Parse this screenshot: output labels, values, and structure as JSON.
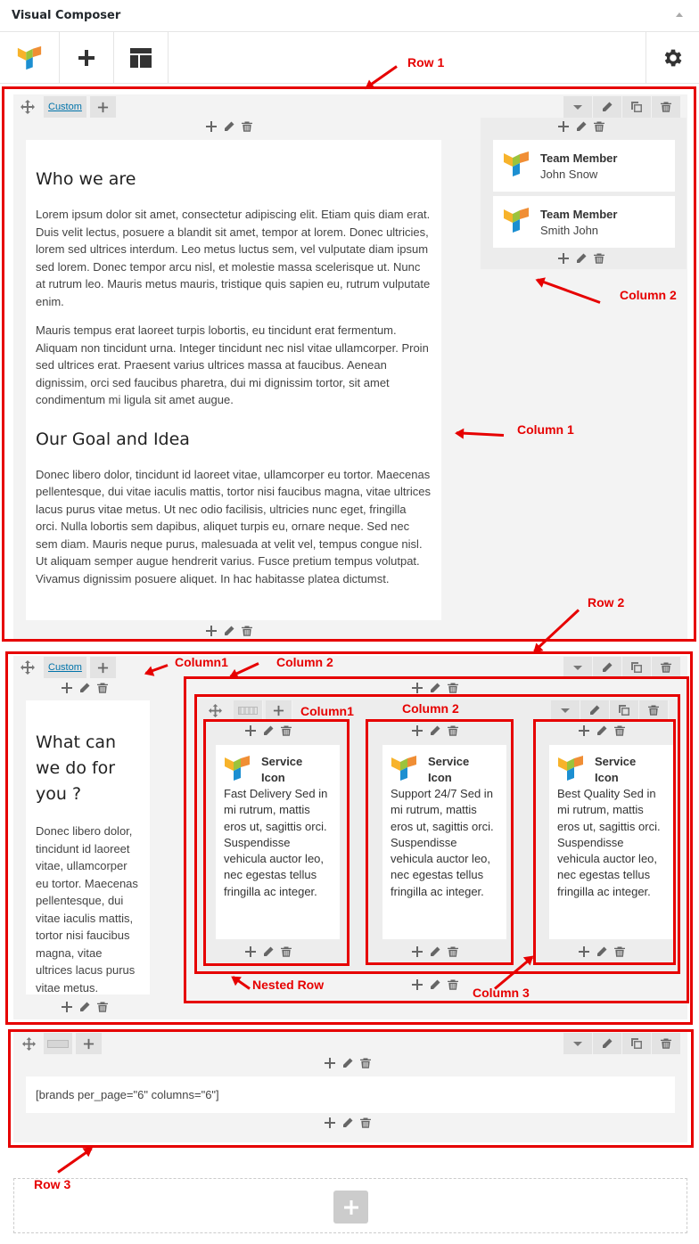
{
  "title": "Visual Composer",
  "row1": {
    "custom_label": "Custom",
    "col1": {
      "heading1": "Who we are",
      "para1": "Lorem ipsum dolor sit amet, consectetur adipiscing elit. Etiam quis diam erat. Duis velit lectus, posuere a blandit sit amet, tempor at lorem. Donec ultricies, lorem sed ultrices interdum. Leo metus luctus sem, vel vulputate diam ipsum sed lorem. Donec tempor arcu nisl, et molestie massa scelerisque ut. Nunc at rutrum leo. Mauris metus mauris, tristique quis sapien eu, rutrum vulputate enim.",
      "para2": "Mauris tempus erat laoreet turpis lobortis, eu tincidunt erat fermentum. Aliquam non tincidunt urna. Integer tincidunt nec nisl vitae ullamcorper. Proin sed ultrices erat. Praesent varius ultrices massa at faucibus. Aenean dignissim, orci sed faucibus pharetra, dui mi dignissim tortor, sit amet condimentum mi ligula sit amet augue.",
      "heading2": "Our Goal and Idea",
      "para3": "Donec libero dolor, tincidunt id laoreet vitae, ullamcorper eu tortor. Maecenas pellentesque, dui vitae iaculis mattis, tortor nisi faucibus magna, vitae ultrices lacus purus vitae metus. Ut nec odio facilisis, ultricies nunc eget, fringilla orci. Nulla lobortis sem dapibus, aliquet turpis eu, ornare neque. Sed nec sem diam. Mauris neque purus, malesuada at velit vel, tempus congue nisl. Ut aliquam semper augue hendrerit varius. Fusce pretium tempus volutpat. Vivamus dignissim posuere aliquet. In hac habitasse platea dictumst."
    },
    "col2": {
      "members": [
        {
          "title": "Team Member",
          "name": "John Snow"
        },
        {
          "title": "Team Member",
          "name": "Smith John"
        }
      ]
    }
  },
  "row2": {
    "custom_label": "Custom",
    "col1": {
      "heading": "What can we do for you ?",
      "para": "Donec libero dolor, tincidunt id laoreet vitae, ullamcorper eu tortor. Maecenas pellentesque, dui vitae iaculis mattis, tortor nisi faucibus magna, vitae ultrices lacus purus vitae metus."
    },
    "services": [
      {
        "title1": "Service",
        "title2": "Icon",
        "text": "Fast Delivery Sed in mi rutrum, mattis eros ut, sagittis orci. Suspendisse vehicula auctor leo, nec egestas tellus fringilla ac integer."
      },
      {
        "title1": "Service",
        "title2": "Icon",
        "text": "Support 24/7 Sed in mi rutrum, mattis eros ut, sagittis orci. Suspendisse vehicula auctor leo, nec egestas tellus fringilla ac integer."
      },
      {
        "title1": "Service",
        "title2": "Icon",
        "text": "Best Quality Sed in mi rutrum, mattis eros ut, sagittis orci. Suspendisse vehicula auctor leo, nec egestas tellus fringilla ac integer."
      }
    ]
  },
  "row3": {
    "shortcode": "[brands per_page=\"6\" columns=\"6\"]"
  },
  "annotations": {
    "row1": "Row 1",
    "row2": "Row 2",
    "row3": "Row 3",
    "column1": "Column 1",
    "column2": "Column 2",
    "r2_column1": "Column1",
    "r2_column2": "Column 2",
    "nested_column1": "Column1",
    "nested_column2": "Column 2",
    "nested_column3": "Column 3",
    "nested_row": "Nested Row"
  },
  "colors": {
    "annotation": "#e60000",
    "link": "#0073aa",
    "panel": "#f3f3f3"
  },
  "icons": [
    "vc-logo-icon",
    "plus-icon",
    "layout-icon",
    "gear-icon",
    "move-icon",
    "chevron-down-icon",
    "pencil-icon",
    "copy-icon",
    "trash-icon"
  ]
}
